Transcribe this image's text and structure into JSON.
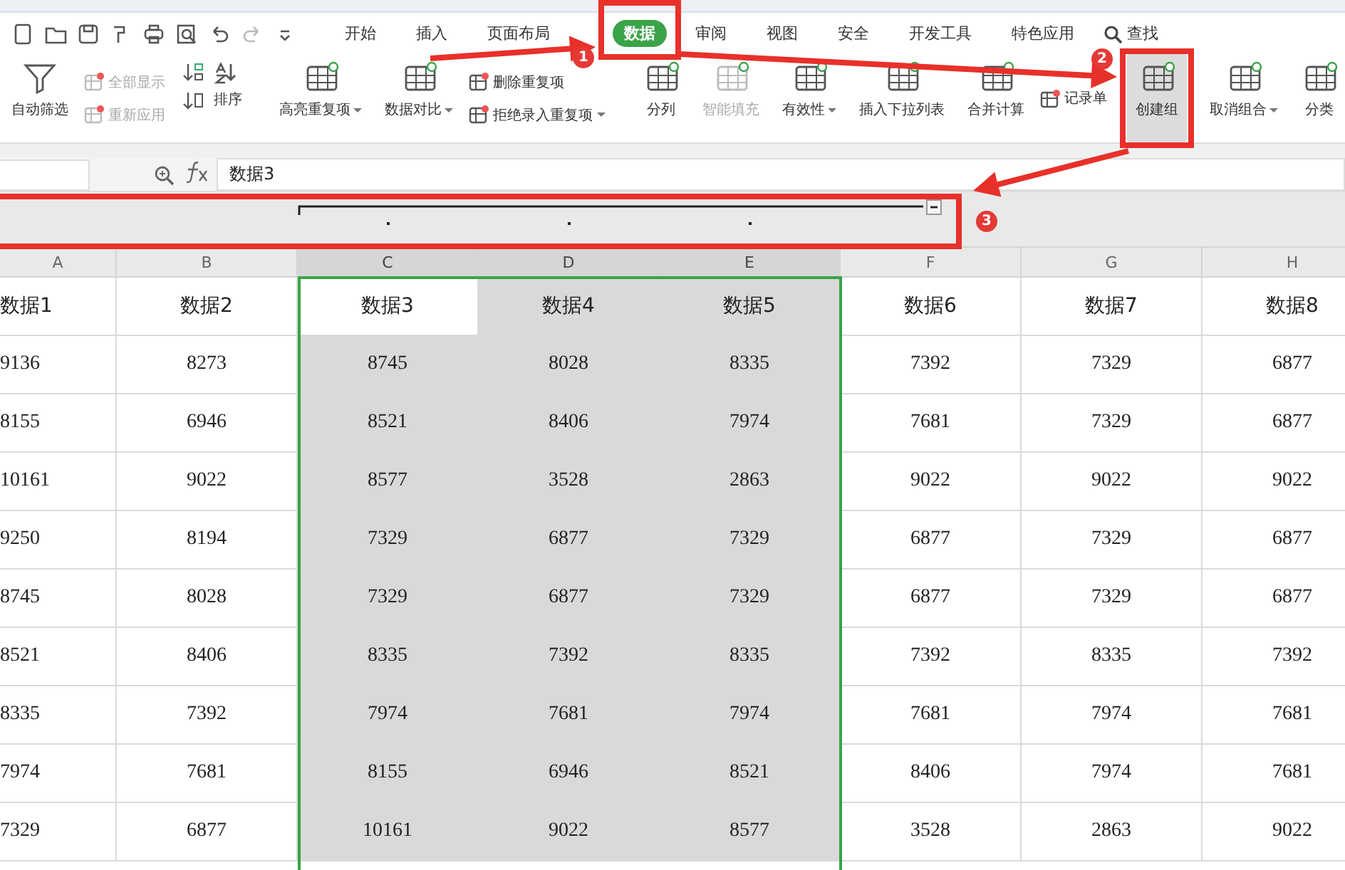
{
  "menu_tabs": [
    {
      "label": "开始",
      "selected": false
    },
    {
      "label": "插入",
      "selected": false
    },
    {
      "label": "页面布局",
      "selected": false
    },
    {
      "label": "数据",
      "selected": true
    },
    {
      "label": "审阅",
      "selected": false
    },
    {
      "label": "视图",
      "selected": false
    },
    {
      "label": "安全",
      "selected": false
    },
    {
      "label": "开发工具",
      "selected": false
    },
    {
      "label": "特色应用",
      "selected": false
    }
  ],
  "search": {
    "label": "查找"
  },
  "ribbon": [
    {
      "kind": "large",
      "label": "自动筛选",
      "disabled": false,
      "dropdown": false
    },
    {
      "kind": "stack",
      "items": [
        {
          "label": "全部显示",
          "disabled": true,
          "dropdown": false
        },
        {
          "label": "重新应用",
          "disabled": true,
          "dropdown": false
        }
      ]
    },
    {
      "kind": "sort",
      "label": "排序",
      "disabled": false,
      "dropdown": false
    },
    {
      "kind": "large",
      "label": "高亮重复项",
      "disabled": false,
      "dropdown": true
    },
    {
      "kind": "large",
      "label": "数据对比",
      "disabled": false,
      "dropdown": true
    },
    {
      "kind": "stack",
      "items": [
        {
          "label": "删除重复项",
          "disabled": false,
          "dropdown": false
        },
        {
          "label": "拒绝录入重复项",
          "disabled": false,
          "dropdown": true
        }
      ]
    },
    {
      "kind": "large",
      "label": "分列",
      "disabled": false,
      "dropdown": false
    },
    {
      "kind": "large",
      "label": "智能填充",
      "disabled": true,
      "dropdown": false
    },
    {
      "kind": "large",
      "label": "有效性",
      "disabled": false,
      "dropdown": true
    },
    {
      "kind": "large",
      "label": "插入下拉列表",
      "disabled": false,
      "dropdown": false
    },
    {
      "kind": "large",
      "label": "合并计算",
      "disabled": false,
      "dropdown": false
    },
    {
      "kind": "stack",
      "items": [
        {
          "label": "记录单",
          "disabled": false,
          "dropdown": false
        }
      ]
    },
    {
      "kind": "large",
      "label": "创建组",
      "disabled": false,
      "dropdown": false,
      "selected": true
    },
    {
      "kind": "large",
      "label": "取消组合",
      "disabled": false,
      "dropdown": true,
      "selected": false
    },
    {
      "kind": "large",
      "label": "分类",
      "disabled": false,
      "dropdown": false
    }
  ],
  "formula_bar": {
    "value": "数据3"
  },
  "columns": [
    {
      "letter": "A",
      "selected": false
    },
    {
      "letter": "B",
      "selected": false
    },
    {
      "letter": "C",
      "selected": true
    },
    {
      "letter": "D",
      "selected": true
    },
    {
      "letter": "E",
      "selected": true
    },
    {
      "letter": "F",
      "selected": false
    },
    {
      "letter": "G",
      "selected": false
    },
    {
      "letter": "H",
      "selected": false
    }
  ],
  "header_row": [
    "数据1",
    "数据2",
    "数据3",
    "数据4",
    "数据5",
    "数据6",
    "数据7",
    "数据8"
  ],
  "rows": [
    [
      "9136",
      "8273",
      "8745",
      "8028",
      "8335",
      "7392",
      "7329",
      "6877"
    ],
    [
      "8155",
      "6946",
      "8521",
      "8406",
      "7974",
      "7681",
      "7329",
      "6877"
    ],
    [
      "10161",
      "9022",
      "8577",
      "3528",
      "2863",
      "9022",
      "9022",
      "9022"
    ],
    [
      "9250",
      "8194",
      "7329",
      "6877",
      "7329",
      "6877",
      "7329",
      "6877"
    ],
    [
      "8745",
      "8028",
      "7329",
      "6877",
      "7329",
      "6877",
      "7329",
      "6877"
    ],
    [
      "8521",
      "8406",
      "8335",
      "7392",
      "8335",
      "7392",
      "8335",
      "7392"
    ],
    [
      "8335",
      "7392",
      "7974",
      "7681",
      "7974",
      "7681",
      "7974",
      "7681"
    ],
    [
      "7974",
      "7681",
      "8155",
      "6946",
      "8521",
      "8406",
      "7974",
      "7681"
    ],
    [
      "7329",
      "6877",
      "10161",
      "9022",
      "8577",
      "3528",
      "2863",
      "9022"
    ]
  ],
  "step_markers": [
    {
      "label": "1"
    },
    {
      "label": "2"
    },
    {
      "label": "3"
    }
  ]
}
